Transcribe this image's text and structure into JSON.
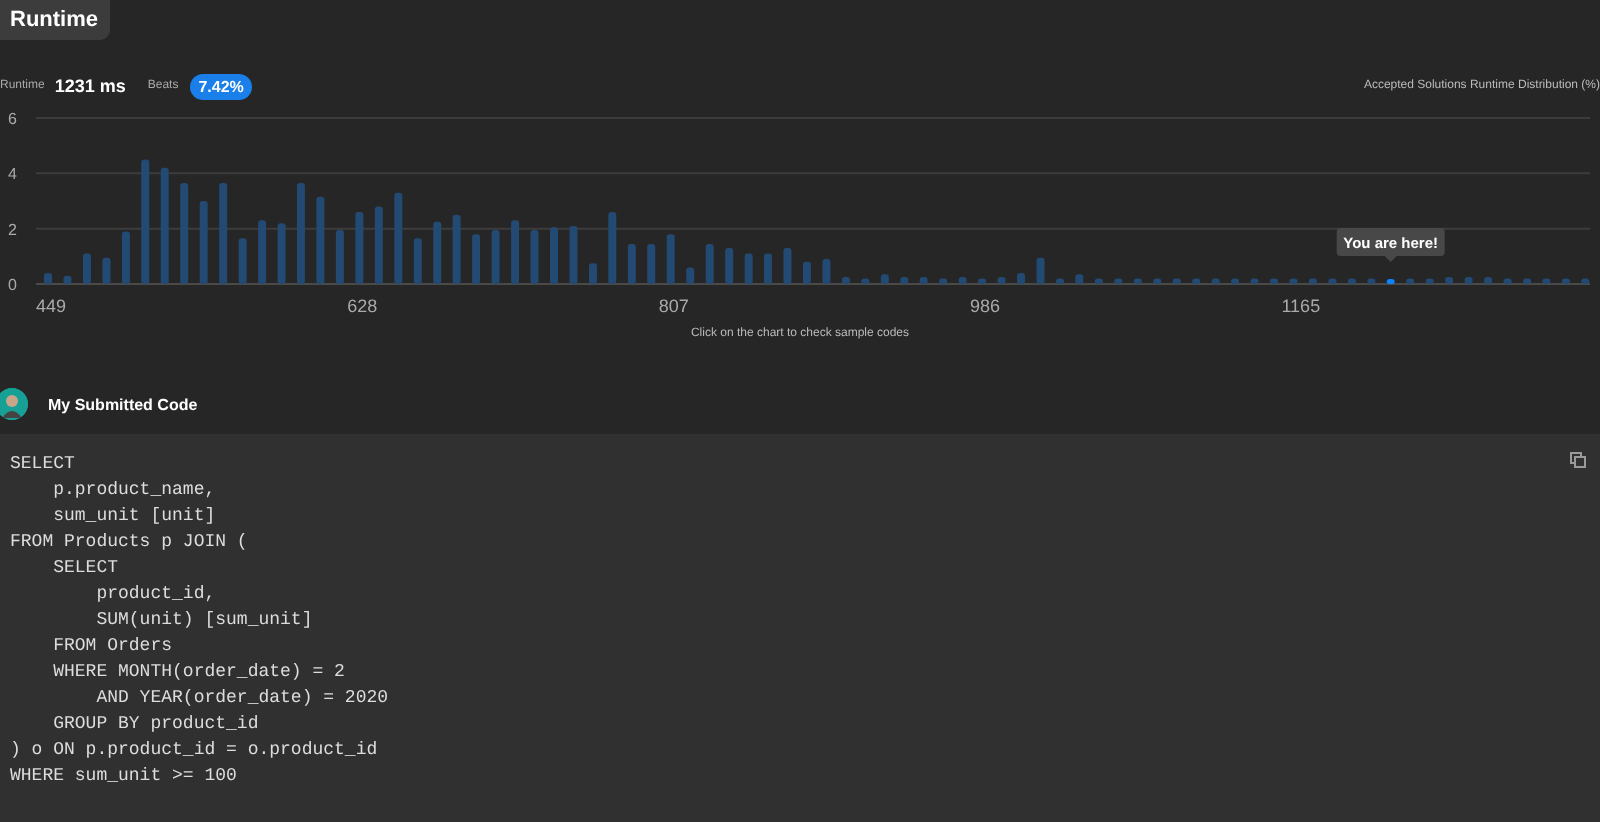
{
  "header_tab": {
    "label": "Runtime",
    "selected": true
  },
  "stats": {
    "runtime_label": "Runtime",
    "runtime_value": "1231 ms",
    "beats_label": "Beats",
    "beats_value": "7.42%"
  },
  "chart_data": {
    "type": "bar",
    "title": "Accepted Solutions Runtime Distribution (%)",
    "x": [
      449,
      460.2,
      471.4,
      482.6,
      493.8,
      504.9,
      516.1,
      527.3,
      538.5,
      549.7,
      560.9,
      572.1,
      583.3,
      594.4,
      605.6,
      616.8,
      628,
      639.2,
      650.4,
      661.6,
      672.8,
      683.9,
      695.1,
      706.3,
      717.5,
      728.7,
      739.9,
      751.1,
      762.3,
      773.4,
      784.6,
      795.8,
      807,
      818.2,
      829.4,
      840.6,
      851.8,
      862.9,
      874.1,
      885.3,
      896.5,
      907.7,
      918.9,
      930.1,
      941.3,
      952.4,
      963.6,
      974.8,
      986,
      997.2,
      1008.4,
      1019.6,
      1030.8,
      1041.9,
      1053.1,
      1064.3,
      1075.5,
      1086.7,
      1097.9,
      1109.1,
      1120.3,
      1131.4,
      1142.6,
      1153.8,
      1165,
      1176.2,
      1187.4,
      1198.6,
      1209.8,
      1220.9,
      1232.1,
      1243.3,
      1254.5,
      1265.7,
      1276.9,
      1288.1,
      1299.3,
      1310.4,
      1321.6,
      1332.8
    ],
    "series": [
      {
        "color": "#234a73",
        "values": [
          0.4,
          0.3,
          1.1,
          0.95,
          1.9,
          4.5,
          4.2,
          3.65,
          3.0,
          3.65,
          1.65,
          2.3,
          2.2,
          3.65,
          3.15,
          1.95,
          2.6,
          2.8,
          3.3,
          1.65,
          2.25,
          2.5,
          1.8,
          1.95,
          2.3,
          1.95,
          2.05,
          2.1,
          0.75,
          2.6,
          1.45,
          1.45,
          1.8,
          0.6,
          1.45,
          1.3,
          1.1,
          1.1,
          1.3,
          0.8,
          0.9,
          0.25,
          0.2,
          0.35,
          0.25,
          0.25,
          0.2,
          0.25,
          0.2,
          0.25,
          0.4,
          0.95,
          0.2,
          0.35,
          0.2,
          0.2,
          0.2,
          0.2,
          0.2,
          0.2,
          0.2,
          0.2,
          0.2,
          0.2,
          0.2,
          0.2,
          0.2,
          0.2,
          0.2,
          null,
          0.2,
          0.2,
          0.25,
          0.25,
          0.25,
          0.2,
          0.2,
          0.2,
          0.2,
          0.2
        ]
      },
      {
        "name": "You are here!",
        "color": "#0a84ff",
        "values": [
          null,
          null,
          null,
          null,
          null,
          null,
          null,
          null,
          null,
          null,
          null,
          null,
          null,
          null,
          null,
          null,
          null,
          null,
          null,
          null,
          null,
          null,
          null,
          null,
          null,
          null,
          null,
          null,
          null,
          null,
          null,
          null,
          null,
          null,
          null,
          null,
          null,
          null,
          null,
          null,
          null,
          null,
          null,
          null,
          null,
          null,
          null,
          null,
          null,
          null,
          null,
          null,
          null,
          null,
          null,
          null,
          null,
          null,
          null,
          null,
          null,
          null,
          null,
          null,
          null,
          null,
          null,
          null,
          null,
          0.15,
          null,
          null,
          null,
          null,
          null,
          null,
          null,
          null,
          null,
          null
        ]
      }
    ],
    "xlim": [
      449,
      1332.8
    ],
    "ylim": [
      0,
      6
    ],
    "yticks": [
      0,
      2,
      4,
      6
    ],
    "xticks": [
      449,
      628,
      807,
      986,
      1165
    ]
  },
  "chart_hint": "Click on the chart to check sample codes",
  "submission": {
    "title": "My Submitted Code"
  },
  "code_lines": [
    "SELECT",
    "    p.product_name,",
    "    sum_unit [unit]",
    "FROM Products p JOIN (",
    "    SELECT",
    "        product_id,",
    "        SUM(unit) [sum_unit]",
    "    FROM Orders",
    "    WHERE MONTH(order_date) = 2",
    "        AND YEAR(order_date) = 2020",
    "    GROUP BY product_id",
    ") o ON p.product_id = o.product_id",
    "WHERE sum_unit >= 100"
  ]
}
